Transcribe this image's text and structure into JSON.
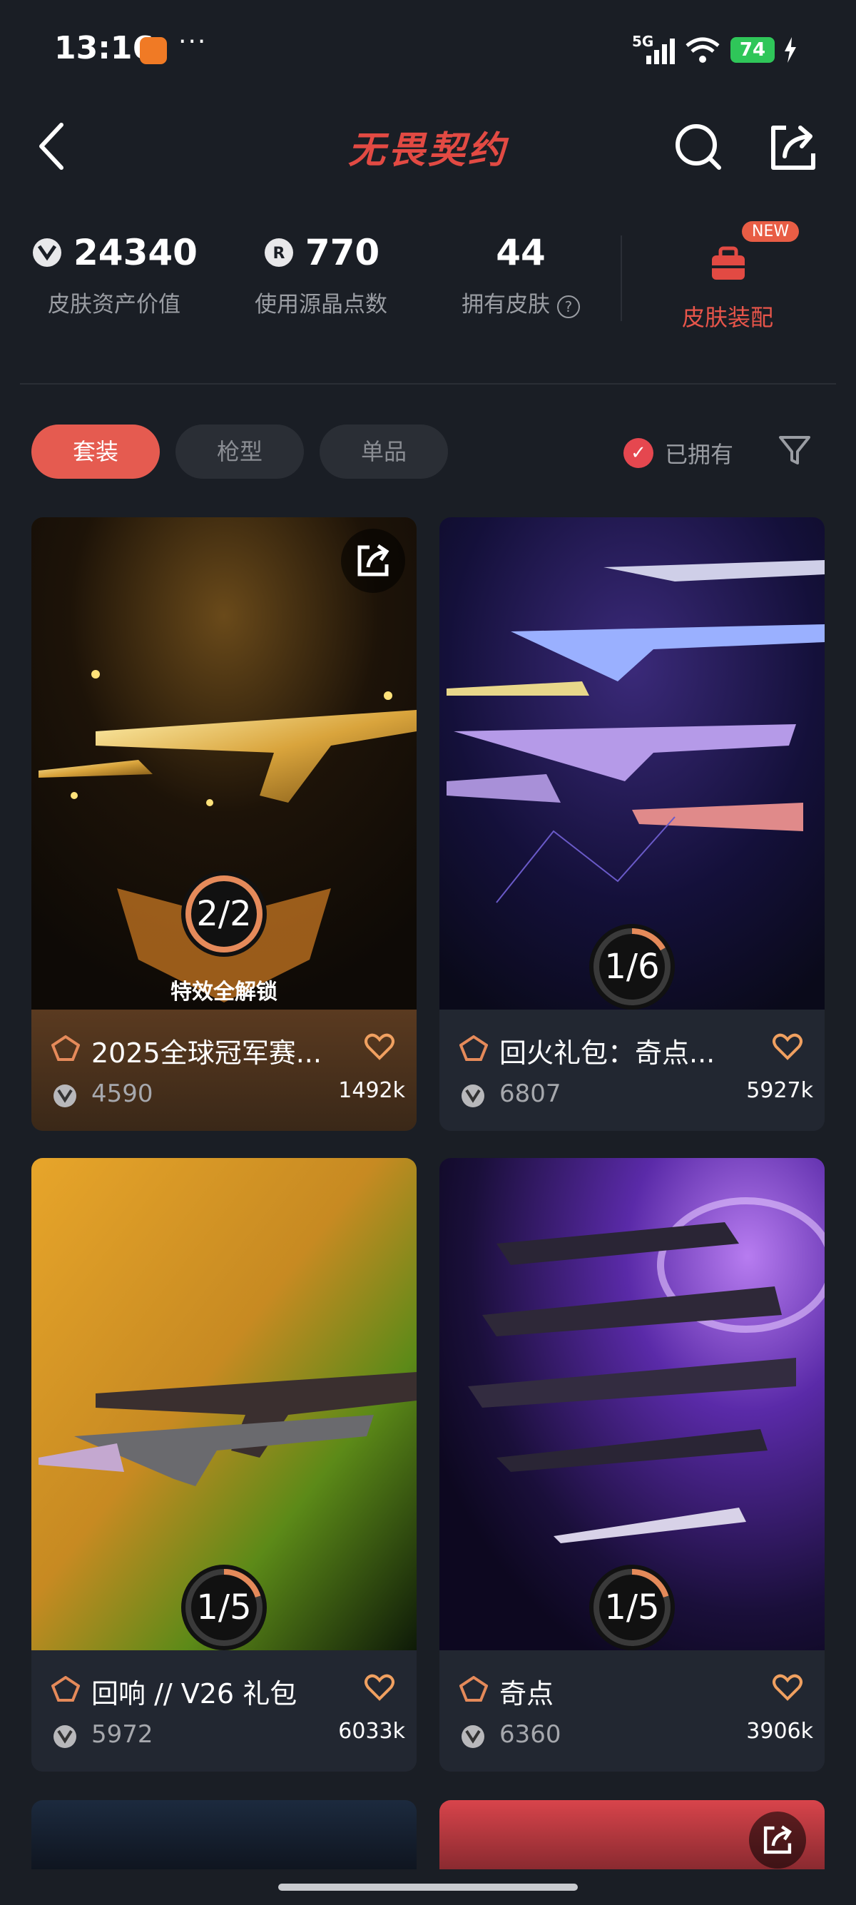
{
  "status": {
    "time": "13:16",
    "dots": "···",
    "network": "5G",
    "battery": "74"
  },
  "header": {
    "title": "无畏契约"
  },
  "stats": [
    {
      "value": "24340",
      "label": "皮肤资产价值",
      "icon": "vp-icon"
    },
    {
      "value": "770",
      "label": "使用源晶点数",
      "icon": "radianite-icon"
    },
    {
      "value": "44",
      "label": "拥有皮肤",
      "icon": "help-icon"
    }
  ],
  "outfit": {
    "badge": "NEW",
    "label": "皮肤装配"
  },
  "tabs": [
    {
      "label": "套装",
      "active": true
    },
    {
      "label": "枪型",
      "active": false
    },
    {
      "label": "单品",
      "active": false
    }
  ],
  "filter": {
    "owned_label": "已拥有"
  },
  "cards": [
    {
      "title": "2025全球冠军赛...",
      "price": "4590",
      "likes": "1492k",
      "progress": "2/2",
      "progress_fraction": 1.0,
      "unlock_text": "特效全解锁",
      "theme": "gold"
    },
    {
      "title": "回火礼包：奇点...",
      "price": "6807",
      "likes": "5927k",
      "progress": "1/6",
      "progress_fraction": 0.1667,
      "theme": "purple-blue"
    },
    {
      "title": "回响 // V26 礼包",
      "price": "5972",
      "likes": "6033k",
      "progress": "1/5",
      "progress_fraction": 0.2,
      "theme": "orange-green"
    },
    {
      "title": "奇点",
      "price": "6360",
      "likes": "3906k",
      "progress": "1/5",
      "progress_fraction": 0.2,
      "theme": "violet"
    }
  ],
  "colors": {
    "accent": "#e55b50",
    "background": "#1a1e25",
    "card": "#222731",
    "progress": "#e58a5a"
  }
}
